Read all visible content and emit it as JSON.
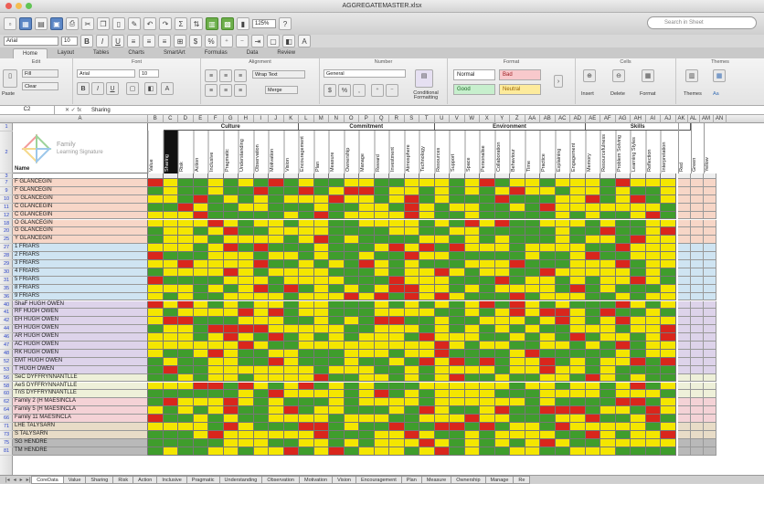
{
  "window": {
    "title": "AGGREGATEMASTER.xlsx"
  },
  "toolbar": {
    "zoom": "125%",
    "search_placeholder": "Search in Sheet"
  },
  "format_bar": {
    "font": "Arial",
    "size": "10"
  },
  "ribbon_tabs": [
    "Home",
    "Layout",
    "Tables",
    "Charts",
    "SmartArt",
    "Formulas",
    "Data",
    "Review"
  ],
  "ribbon": {
    "groups": {
      "edit": "Edit",
      "font": "Font",
      "alignment": "Alignment",
      "number": "Number",
      "format": "Format",
      "cells": "Cells",
      "themes": "Themes"
    },
    "fill_label": "Fill",
    "clear_label": "Clear",
    "paste_label": "Paste",
    "font_name": "Arial",
    "font_size": "10",
    "wrap_text": "Wrap Text",
    "merge": "Merge",
    "number_format": "General",
    "conditional_formatting": "Conditional Formatting",
    "styles": {
      "normal": "Normal",
      "bad": "Bad",
      "good": "Good",
      "neutral": "Neutral"
    },
    "cells": {
      "insert": "Insert",
      "delete": "Delete",
      "format": "Format"
    },
    "themes": {
      "themes": "Themes",
      "aa": "Aa"
    }
  },
  "formula_bar": {
    "cell": "C2",
    "value": "Sharing"
  },
  "columns": [
    "A",
    "B",
    "C",
    "D",
    "E",
    "F",
    "G",
    "H",
    "I",
    "J",
    "K",
    "L",
    "M",
    "N",
    "O",
    "P",
    "Q",
    "R",
    "S",
    "T",
    "U",
    "V",
    "W",
    "X",
    "Y",
    "Z",
    "AA",
    "AB",
    "AC",
    "AD",
    "AE",
    "AF",
    "AG",
    "AH",
    "AI",
    "AJ",
    "AK",
    "AL",
    "AM",
    "AN"
  ],
  "logo": {
    "line1": "Family",
    "line2": "Learning Signature"
  },
  "groups_header": [
    {
      "label": "Culture",
      "from": 1,
      "to": 10
    },
    {
      "label": "Commitment",
      "from": 10,
      "to": 19
    },
    {
      "label": "Environment",
      "from": 19,
      "to": 29
    },
    {
      "label": "Skills",
      "from": 29,
      "to": 36
    }
  ],
  "attributes": [
    "Value",
    "Sharing",
    "Risk",
    "Action",
    "Inclusive",
    "Pragmatic",
    "Understanding",
    "Observation",
    "Motivation",
    "Vision",
    "Encouragement",
    "Plan",
    "Measure",
    "Ownership",
    "Manage",
    "Reward",
    "Investment",
    "Atmosphere",
    "Technology",
    "Resources",
    "Support",
    "Space",
    "Personalise",
    "Collaboration",
    "Behaviour",
    "Time",
    "Practice",
    "Explaining",
    "Engagement",
    "Memory",
    "Resourcefulness",
    "Problem Solving",
    "Learning Styles",
    "Reflection",
    "Interpretation"
  ],
  "tail_headers": [
    "Red",
    "Green",
    "Yellow"
  ],
  "name_header": "Name",
  "rows": [
    {
      "n": "3",
      "name": "",
      "band": "blank"
    },
    {
      "n": "7",
      "name": "F GLANCEGIN",
      "band": "salmon"
    },
    {
      "n": "9",
      "name": "F GLANCEGIN",
      "band": "salmon"
    },
    {
      "n": "10",
      "name": "G GLANCEGIN",
      "band": "salmon"
    },
    {
      "n": "11",
      "name": "C GLANCEGIN",
      "band": "salmon"
    },
    {
      "n": "12",
      "name": "C GLANCEGIN",
      "band": "salmon"
    },
    {
      "n": "18",
      "name": "O GLANCEGIN",
      "band": "salmon"
    },
    {
      "n": "20",
      "name": "G GLANCEGIN",
      "band": "salmon"
    },
    {
      "n": "25",
      "name": "Y GLANCEGIN",
      "band": "salmon"
    },
    {
      "n": "27",
      "name": "1 FRIARS",
      "band": "blue"
    },
    {
      "n": "28",
      "name": "2 FRIARS",
      "band": "blue"
    },
    {
      "n": "29",
      "name": "3 FRIARS",
      "band": "blue"
    },
    {
      "n": "30",
      "name": "4 FRIARS",
      "band": "blue"
    },
    {
      "n": "31",
      "name": "5 FRIARS",
      "band": "blue"
    },
    {
      "n": "35",
      "name": "8 FRIARS",
      "band": "blue"
    },
    {
      "n": "36",
      "name": "9 FRIARS",
      "band": "blue"
    },
    {
      "n": "40",
      "name": "ShaF HUGH OWEN",
      "band": "lilac"
    },
    {
      "n": "41",
      "name": "RF HUGH OWEN",
      "band": "lilac"
    },
    {
      "n": "42",
      "name": "EH HUGH OWEN",
      "band": "lilac"
    },
    {
      "n": "44",
      "name": "EH HUGH OWEN",
      "band": "lilac"
    },
    {
      "n": "46",
      "name": "AR HUGH OWEN",
      "band": "lilac"
    },
    {
      "n": "47",
      "name": "AC HUGH OWEN",
      "band": "lilac"
    },
    {
      "n": "48",
      "name": "RK HUGH OWEN",
      "band": "lilac"
    },
    {
      "n": "52",
      "name": "EMT HUGH OWEN",
      "band": "lilac"
    },
    {
      "n": "53",
      "name": "T HUGH OWEN",
      "band": "lilac"
    },
    {
      "n": "56",
      "name": "SeC DYFFRYNNANTLLE",
      "band": "cream"
    },
    {
      "n": "58",
      "name": "AeS DYFFRYNNANTLLE",
      "band": "cream"
    },
    {
      "n": "60",
      "name": "TnS DYFFRYNNANTLLE",
      "band": "cream"
    },
    {
      "n": "62",
      "name": "Family 2 (H MAESINCLA",
      "band": "pink"
    },
    {
      "n": "64",
      "name": "Family 5 (H MAESINCLA",
      "band": "pink"
    },
    {
      "n": "66",
      "name": "Family 11 MAESINCLA",
      "band": "pink"
    },
    {
      "n": "71",
      "name": "LHE TALYSARN",
      "band": "tan"
    },
    {
      "n": "73",
      "name": "S TALYSARN",
      "band": "tan"
    },
    {
      "n": "75",
      "name": "SG HENDRE",
      "band": "grey"
    },
    {
      "n": "81",
      "name": "TM HENDRE",
      "band": "grey"
    }
  ],
  "sheet_tabs": [
    "CoreData",
    "Value",
    "Sharing",
    "Risk",
    "Action",
    "Inclusive",
    "Pragmatic",
    "Understanding",
    "Observation",
    "Motivation",
    "Vision",
    "Encouragement",
    "Plan",
    "Measure",
    "Ownership",
    "Manage",
    "Re"
  ],
  "colors": {
    "red": "#d9261c",
    "green": "#3f9d2c",
    "yellow": "#f4e600",
    "band_salmon": "#f7d6c7",
    "band_blue": "#cfe4f2",
    "band_lilac": "#ddd3ea",
    "band_cream": "#eef0d9",
    "band_pink": "#f4d2d6",
    "band_tan": "#e8dcc7",
    "band_grey": "#b9b9b9"
  }
}
